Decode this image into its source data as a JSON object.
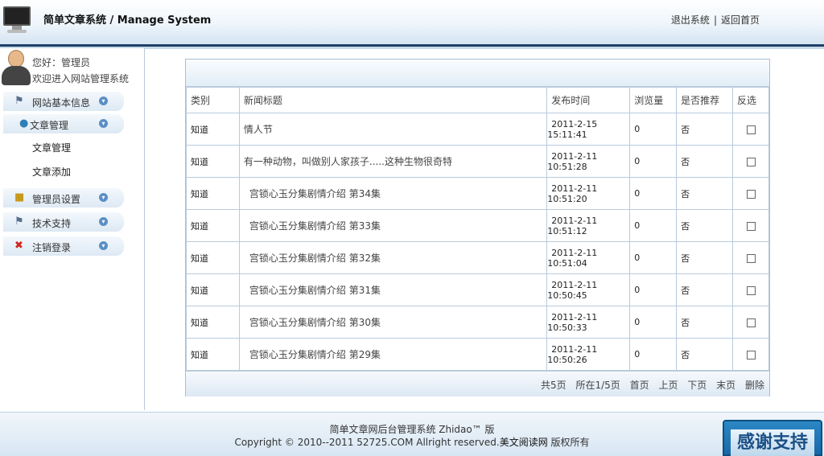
{
  "header": {
    "title": "简单文章系统 / Manage System",
    "logout": "退出系统",
    "separator": "|",
    "home": "返回首页"
  },
  "sidebar": {
    "greeting": "您好：管理员",
    "welcome": "欢迎进入网站管理系统",
    "items": [
      {
        "label": "网站基本信息",
        "icon": "flag-icon"
      },
      {
        "label": "文章管理",
        "icon": "folder-icon"
      },
      {
        "label": "管理员设置",
        "icon": "lock-icon"
      },
      {
        "label": "技术支持",
        "icon": "flag-icon"
      },
      {
        "label": "注销登录",
        "icon": "close-icon"
      }
    ],
    "sub_items": [
      "文章管理",
      "文章添加"
    ]
  },
  "table": {
    "headers": [
      "类别",
      "新闻标题",
      "发布时间",
      "浏览量",
      "是否推荐",
      "反选"
    ],
    "rows": [
      {
        "category": "知道",
        "title": "情人节",
        "date": "2011-2-15",
        "time": "15:11:41",
        "views": "0",
        "recommend": "否"
      },
      {
        "category": "知道",
        "title": "有一种动物，叫做别人家孩子.....这种生物很奇特",
        "date": "2011-2-11",
        "time": "10:51:28",
        "views": "0",
        "recommend": "否"
      },
      {
        "category": "知道",
        "title": "宫锁心玉分集剧情介绍 第34集",
        "date": "2011-2-11",
        "time": "10:51:20",
        "views": "0",
        "recommend": "否"
      },
      {
        "category": "知道",
        "title": "宫锁心玉分集剧情介绍 第33集",
        "date": "2011-2-11",
        "time": "10:51:12",
        "views": "0",
        "recommend": "否"
      },
      {
        "category": "知道",
        "title": "宫锁心玉分集剧情介绍 第32集",
        "date": "2011-2-11",
        "time": "10:51:04",
        "views": "0",
        "recommend": "否"
      },
      {
        "category": "知道",
        "title": "宫锁心玉分集剧情介绍 第31集",
        "date": "2011-2-11",
        "time": "10:50:45",
        "views": "0",
        "recommend": "否"
      },
      {
        "category": "知道",
        "title": "宫锁心玉分集剧情介绍 第30集",
        "date": "2011-2-11",
        "time": "10:50:33",
        "views": "0",
        "recommend": "否"
      },
      {
        "category": "知道",
        "title": "宫锁心玉分集剧情介绍 第29集",
        "date": "2011-2-11",
        "time": "10:50:26",
        "views": "0",
        "recommend": "否"
      }
    ]
  },
  "pager": {
    "total": "共5页",
    "current": "所在1/5页",
    "first": "首页",
    "prev": "上页",
    "next": "下页",
    "last": "末页",
    "delete": "删除"
  },
  "footer": {
    "line1": "简单文章网后台管理系统 Zhidao™ 版",
    "line2_prefix": "Copyright © 2010--2011 52725.COM Allright reserved.",
    "line2_link": "美文阅读网",
    "line2_suffix": " 版权所有"
  },
  "thanks_badge": "感谢支持",
  "colors": {
    "header_border": "#1e3f66",
    "table_border": "#b8cbdd",
    "badge": "#1769a6"
  }
}
